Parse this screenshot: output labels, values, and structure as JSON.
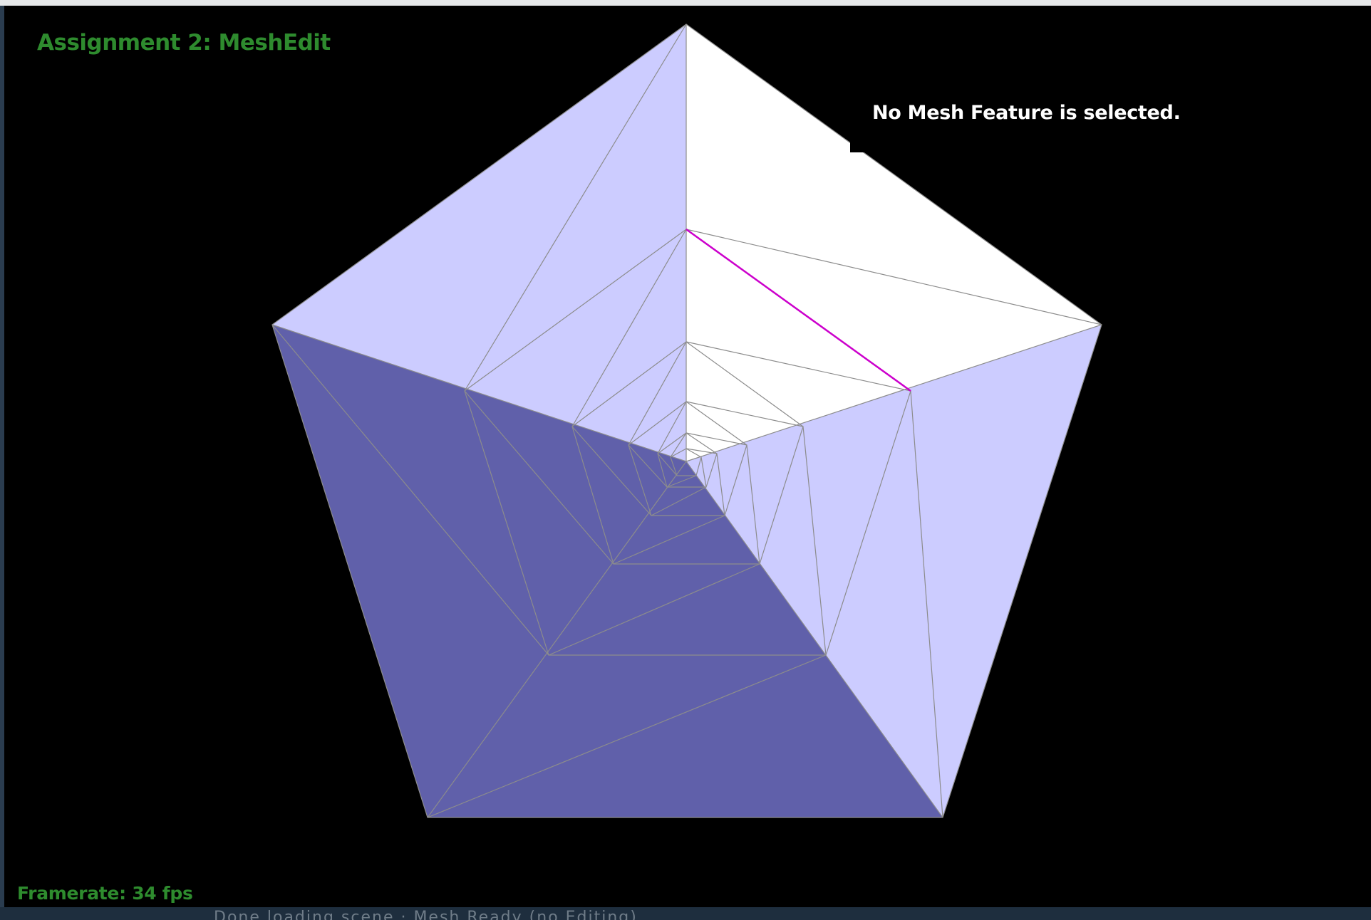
{
  "app": {
    "title": "Assignment 2: MeshEdit",
    "selection_status": "No Mesh Feature is selected.",
    "framerate_label": "Framerate: 34 fps",
    "background_status_text": "Done loading scene · Mesh Ready (no Editing)"
  },
  "colors": {
    "viewport_background": "#000000",
    "overlay_text_green": "#2e8b2e",
    "overlay_text_white": "#ffffff",
    "face_light": "#ccccff",
    "face_dark": "#6060aa",
    "face_white": "#ffffff",
    "wireframe": "#8c8c8c",
    "selected_edge": "#cc00cc"
  }
}
